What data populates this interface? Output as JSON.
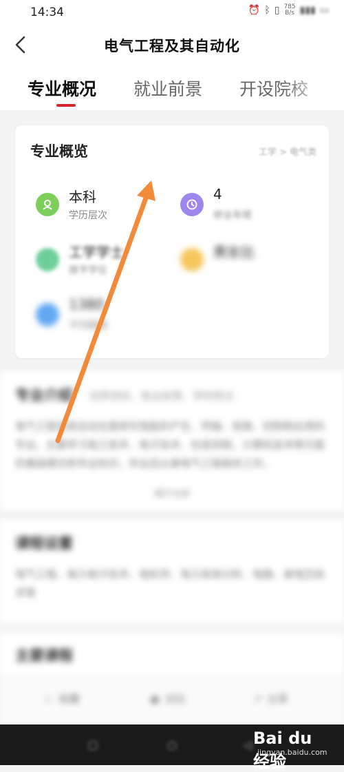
{
  "status_bar": {
    "time": "14:34",
    "net_speed_value": "785",
    "net_speed_unit": "B/s"
  },
  "header": {
    "title": "电气工程及其自动化"
  },
  "tabs": [
    {
      "label": "专业概况",
      "active": true
    },
    {
      "label": "就业前景",
      "active": false
    },
    {
      "label": "开设院校",
      "active": false
    }
  ],
  "overview": {
    "title": "专业概览",
    "breadcrumb": "工学 > 电气类",
    "items": [
      {
        "value": "本科",
        "label": "学历层次",
        "icon": "person-icon",
        "color": "#7ccf5a"
      },
      {
        "value": "4",
        "label": "修业年限",
        "icon": "clock-icon",
        "color": "#9e86ef"
      },
      {
        "value": "工学学士",
        "label": "授予学位",
        "icon": "degree-icon",
        "color": "#6fcf9a"
      },
      {
        "value": "男女比",
        "label": "",
        "icon": "gender-icon",
        "color": "#f6c65a"
      },
      {
        "value": "1380",
        "label": "平均薪酬",
        "icon": "money-icon",
        "color": "#62a8f2"
      }
    ]
  },
  "intro": {
    "title": "专业介绍",
    "subtitle": "培养目标、就业前景、学科特点",
    "text": "电气工程及其自动化是研究电能的产生、传输、变换、控制和应用的专业，主要学习电工技术、电子技术、信息控制、计算机技术等方面的基础理论和专业知识，毕业后从事电气工程相关工作。",
    "expand": "展开全部"
  },
  "courses": {
    "title": "课程设置",
    "text": "电气工程、电力电子技术、电机学、电力系统分析、电路、高电压技术等"
  },
  "famous": {
    "title": "主要课程"
  },
  "actions": [
    {
      "label": "收藏",
      "icon": "star-icon"
    },
    {
      "label": "对比",
      "icon": "compare-icon"
    },
    {
      "label": "分享",
      "icon": "share-icon"
    }
  ],
  "watermark": {
    "brand": "Bai du 经验",
    "url": "jingyan.baidu.com"
  },
  "colors": {
    "accent": "#d8262d",
    "arrow": "#f28a3a",
    "background": "#f4f4f5"
  }
}
